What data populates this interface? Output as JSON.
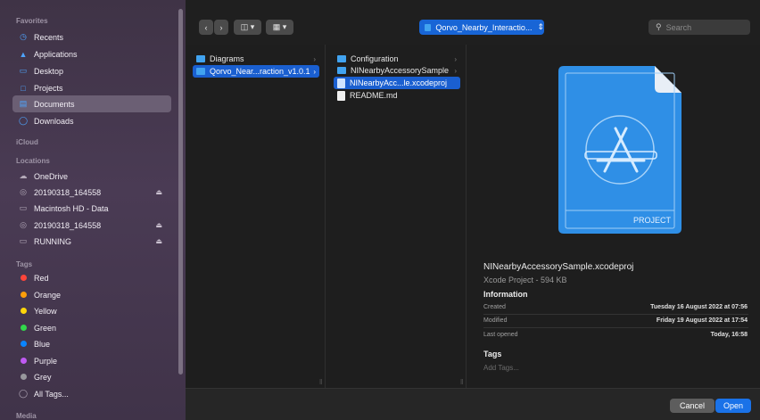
{
  "sidebar": {
    "favorites_header": "Favorites",
    "favorites": [
      {
        "label": "Recents",
        "icon": "clock-icon"
      },
      {
        "label": "Applications",
        "icon": "applications-icon"
      },
      {
        "label": "Desktop",
        "icon": "desktop-icon"
      },
      {
        "label": "Projects",
        "icon": "folder-icon"
      },
      {
        "label": "Documents",
        "icon": "document-icon",
        "selected": true
      },
      {
        "label": "Downloads",
        "icon": "download-icon"
      }
    ],
    "icloud_header": "iCloud",
    "locations_header": "Locations",
    "locations": [
      {
        "label": "OneDrive",
        "icon": "cloud-icon"
      },
      {
        "label": "20190318_164558",
        "icon": "disk-icon",
        "eject": true
      },
      {
        "label": "Macintosh HD - Data",
        "icon": "hard-drive-icon"
      },
      {
        "label": "20190318_164558",
        "icon": "disk-icon",
        "eject": true
      },
      {
        "label": "RUNNING",
        "icon": "hard-drive-icon",
        "eject": true
      }
    ],
    "tags_header": "Tags",
    "tags": [
      {
        "label": "Red",
        "color": "#ff453a"
      },
      {
        "label": "Orange",
        "color": "#ff9f0a"
      },
      {
        "label": "Yellow",
        "color": "#ffd60a"
      },
      {
        "label": "Green",
        "color": "#32d74b"
      },
      {
        "label": "Blue",
        "color": "#0a84ff"
      },
      {
        "label": "Purple",
        "color": "#bf5af2"
      },
      {
        "label": "Grey",
        "color": "#98989d"
      }
    ],
    "all_tags": "All Tags...",
    "media_header": "Media"
  },
  "toolbar": {
    "back_icon": "chevron-left-icon",
    "forward_icon": "chevron-right-icon",
    "path_label": "Qorvo_Nearby_Interactio...",
    "search_placeholder": "Search"
  },
  "columns": {
    "col1": [
      {
        "label": "Diagrams",
        "type": "folder",
        "has_children": true
      },
      {
        "label": "Qorvo_Near...raction_v1.0.1",
        "type": "folder",
        "has_children": true,
        "selected": true
      }
    ],
    "col2": [
      {
        "label": "Configuration",
        "type": "folder",
        "has_children": true
      },
      {
        "label": "NINearbyAccessorySample",
        "type": "folder",
        "has_children": true
      },
      {
        "label": "NINearbyAcc...le.xcodeproj",
        "type": "xcodeproj",
        "selected": true
      },
      {
        "label": "README.md",
        "type": "file"
      }
    ]
  },
  "preview": {
    "badge_label": "PROJECT",
    "filename": "NINearbyAccessorySample.xcodeproj",
    "subtitle": "Xcode Project - 594 KB",
    "info_header": "Information",
    "info": [
      {
        "label": "Created",
        "value": "Tuesday 16 August 2022 at 07:56"
      },
      {
        "label": "Modified",
        "value": "Friday 19 August 2022 at 17:54"
      },
      {
        "label": "Last opened",
        "value": "Today, 16:58"
      }
    ],
    "tags_header": "Tags",
    "add_tags_placeholder": "Add Tags..."
  },
  "buttons": {
    "cancel": "Cancel",
    "open": "Open"
  },
  "colors": {
    "accent": "#1a72e8",
    "selection": "#1a5fd0",
    "folder": "#41a3f0"
  }
}
